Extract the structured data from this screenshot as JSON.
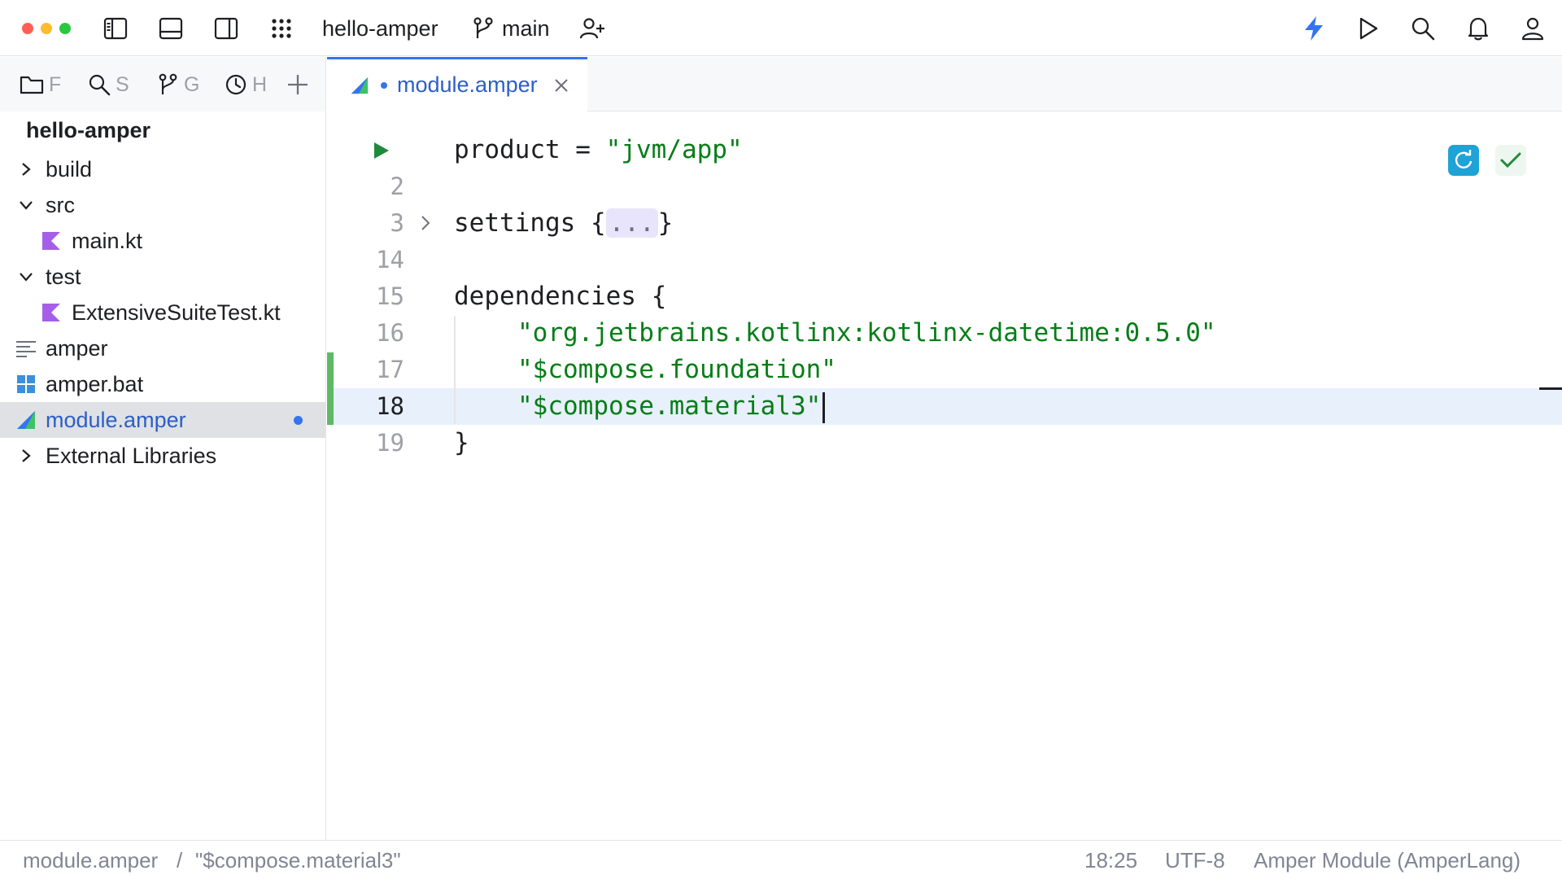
{
  "toolbar": {
    "project_name": "hello-amper",
    "branch": "main"
  },
  "sidebar": {
    "tabs": [
      {
        "icon": "folder-icon",
        "label": "F"
      },
      {
        "icon": "search-icon",
        "label": "S"
      },
      {
        "icon": "git-branch-icon",
        "label": "G"
      },
      {
        "icon": "clock-icon",
        "label": "H"
      }
    ],
    "root": "hello-amper",
    "items": [
      {
        "label": "build",
        "icon": "chevron-right-icon"
      },
      {
        "label": "src",
        "icon": "chevron-down-icon"
      },
      {
        "label": "main.kt",
        "icon": "kotlin-file-icon"
      },
      {
        "label": "test",
        "icon": "chevron-down-icon"
      },
      {
        "label": "ExtensiveSuiteTest.kt",
        "icon": "kotlin-file-icon"
      },
      {
        "label": "amper",
        "icon": "text-file-icon"
      },
      {
        "label": "amper.bat",
        "icon": "windows-icon"
      },
      {
        "label": "module.amper",
        "icon": "amper-icon"
      },
      {
        "label": "External Libraries",
        "icon": "chevron-right-icon"
      }
    ]
  },
  "editor": {
    "tab_label": "module.amper",
    "lines": [
      {
        "num": "",
        "code": "product = ",
        "str": "\"jvm/app\""
      },
      {
        "num": "2"
      },
      {
        "num": "3",
        "code_a": "settings {",
        "fold": "...",
        "code_b": "}"
      },
      {
        "num": "14"
      },
      {
        "num": "15",
        "code": "dependencies {"
      },
      {
        "num": "16",
        "str": "\"org.jetbrains.kotlinx:kotlinx-datetime:0.5.0\""
      },
      {
        "num": "17",
        "str": "\"$compose.foundation\""
      },
      {
        "num": "18",
        "str": "\"$compose.material3\""
      },
      {
        "num": "19",
        "code": "}"
      }
    ]
  },
  "statusbar": {
    "file": "module.amper",
    "separator": "/",
    "path": "\"$compose.material3\"",
    "position": "18:25",
    "encoding": "UTF-8",
    "file_type": "Amper Module (AmperLang)"
  },
  "colors": {
    "accent": "#3574f0",
    "string": "#067d17",
    "run_green": "#208a3c",
    "selection": "#dfe1e5",
    "current_line": "#e8f0fc"
  }
}
